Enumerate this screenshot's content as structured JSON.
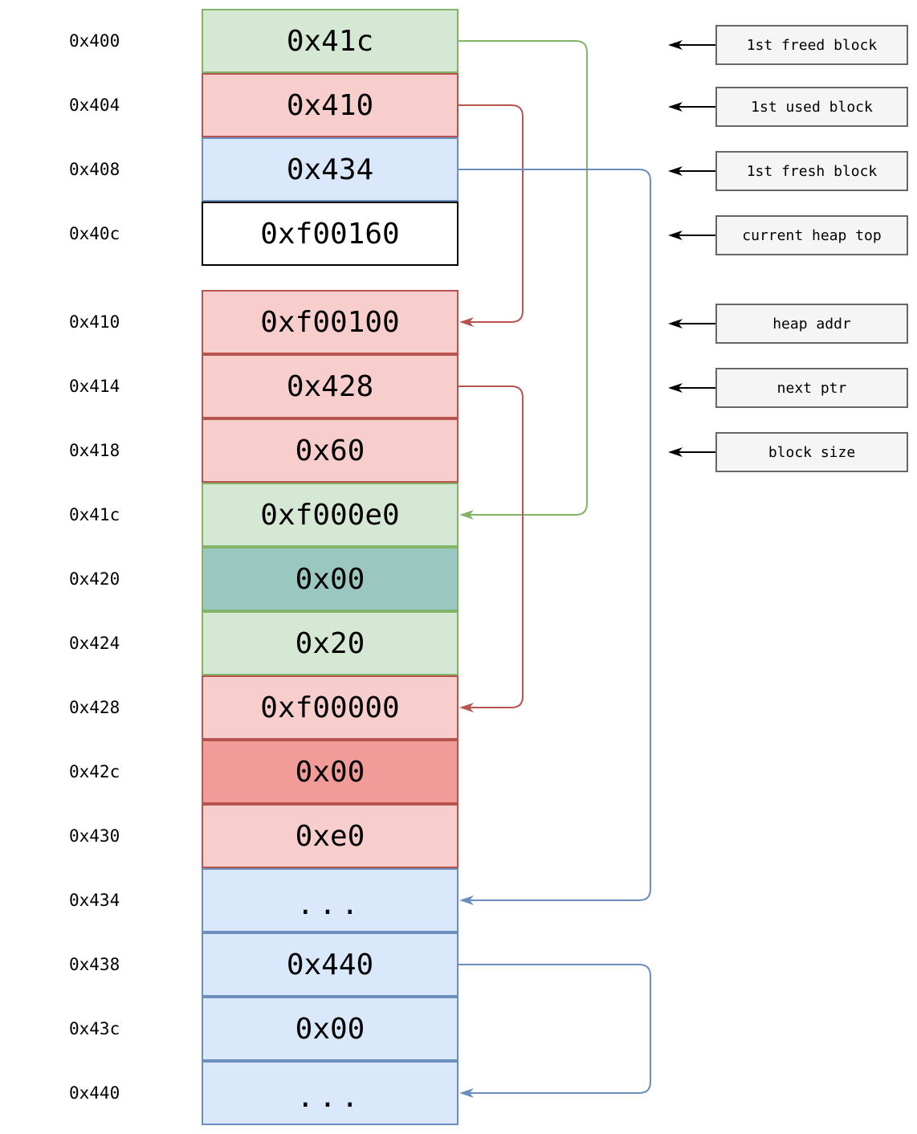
{
  "colors": {
    "green_fill": "#d5e8d4",
    "green_stroke": "#82b366",
    "red_fill": "#f8cecc",
    "red_stroke": "#b85450",
    "blue_fill": "#dae8fc",
    "blue_stroke": "#6c8ebf",
    "teal_fill": "#9ac7bf",
    "dark_red_fill": "#f19c99",
    "white_fill": "#ffffff",
    "black_stroke": "#000000"
  },
  "header_cells": [
    {
      "addr": "0x400",
      "value": "0x41c",
      "fill": "green_fill",
      "stroke": "green_stroke"
    },
    {
      "addr": "0x404",
      "value": "0x410",
      "fill": "red_fill",
      "stroke": "red_stroke"
    },
    {
      "addr": "0x408",
      "value": "0x434",
      "fill": "blue_fill",
      "stroke": "blue_stroke"
    },
    {
      "addr": "0x40c",
      "value": "0xf00160",
      "fill": "white_fill",
      "stroke": "black_stroke"
    }
  ],
  "heap_cells": [
    {
      "addr": "0x410",
      "value": "0xf00100",
      "fill": "red_fill",
      "stroke": "red_stroke"
    },
    {
      "addr": "0x414",
      "value": "0x428",
      "fill": "red_fill",
      "stroke": "red_stroke"
    },
    {
      "addr": "0x418",
      "value": "0x60",
      "fill": "red_fill",
      "stroke": "red_stroke"
    },
    {
      "addr": "0x41c",
      "value": "0xf000e0",
      "fill": "green_fill",
      "stroke": "green_stroke"
    },
    {
      "addr": "0x420",
      "value": "0x00",
      "fill": "teal_fill",
      "stroke": "green_stroke"
    },
    {
      "addr": "0x424",
      "value": "0x20",
      "fill": "green_fill",
      "stroke": "green_stroke"
    },
    {
      "addr": "0x428",
      "value": "0xf00000",
      "fill": "red_fill",
      "stroke": "red_stroke"
    },
    {
      "addr": "0x42c",
      "value": "0x00",
      "fill": "dark_red_fill",
      "stroke": "red_stroke"
    },
    {
      "addr": "0x430",
      "value": "0xe0",
      "fill": "red_fill",
      "stroke": "red_stroke"
    },
    {
      "addr": "0x434",
      "value": "...",
      "fill": "blue_fill",
      "stroke": "blue_stroke"
    },
    {
      "addr": "0x438",
      "value": "0x440",
      "fill": "blue_fill",
      "stroke": "blue_stroke"
    },
    {
      "addr": "0x43c",
      "value": "0x00",
      "fill": "blue_fill",
      "stroke": "blue_stroke"
    },
    {
      "addr": "0x440",
      "value": "...",
      "fill": "blue_fill",
      "stroke": "blue_stroke"
    }
  ],
  "legend": [
    "1st freed block",
    "1st used block",
    "1st fresh block",
    "current heap top",
    "heap addr",
    "next ptr",
    "block size"
  ],
  "pointers": [
    {
      "from": "0x400",
      "to": "0x41c",
      "color": "green_stroke"
    },
    {
      "from": "0x404",
      "to": "0x410",
      "color": "red_stroke"
    },
    {
      "from": "0x408",
      "to": "0x434",
      "color": "blue_stroke"
    },
    {
      "from": "0x414",
      "to": "0x428",
      "color": "red_stroke"
    },
    {
      "from": "0x438",
      "to": "0x440",
      "color": "blue_stroke"
    }
  ]
}
